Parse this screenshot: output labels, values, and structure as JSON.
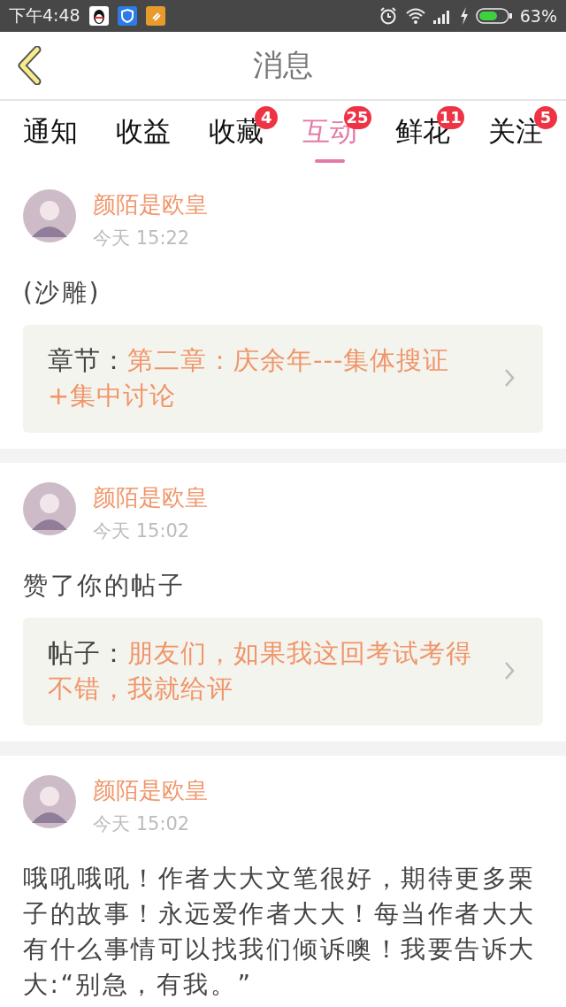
{
  "status_bar": {
    "time": "下午4:48",
    "battery": "63%"
  },
  "header": {
    "title": "消息"
  },
  "tabs": [
    {
      "label": "通知",
      "selected": false
    },
    {
      "label": "收益",
      "selected": false
    },
    {
      "label": "收藏",
      "selected": false,
      "badge": "4"
    },
    {
      "label": "互动",
      "selected": true,
      "badge": "25"
    },
    {
      "label": "鲜花",
      "selected": false,
      "badge": "11"
    },
    {
      "label": "关注",
      "selected": false,
      "badge": "5"
    }
  ],
  "posts": [
    {
      "user": "颜陌是欧皇",
      "time": "今天 15:22",
      "text": "(沙雕)",
      "ref": {
        "label": "章节：",
        "title": "第二章：庆余年---集体搜证+集中讨论"
      }
    },
    {
      "user": "颜陌是欧皇",
      "time": "今天 15:02",
      "text": "赞了你的帖子",
      "ref": {
        "label": "帖子：",
        "title": "朋友们，如果我这回考试考得不错，我就给评"
      }
    },
    {
      "user": "颜陌是欧皇",
      "time": "今天 15:02",
      "text": "哦吼哦吼！作者大大文笔很好，期待更多栗子的故事！永远爱作者大大！每当作者大大有什么事情可以找我们倾诉噢！我要告诉大大:“别急，有我。”"
    }
  ]
}
